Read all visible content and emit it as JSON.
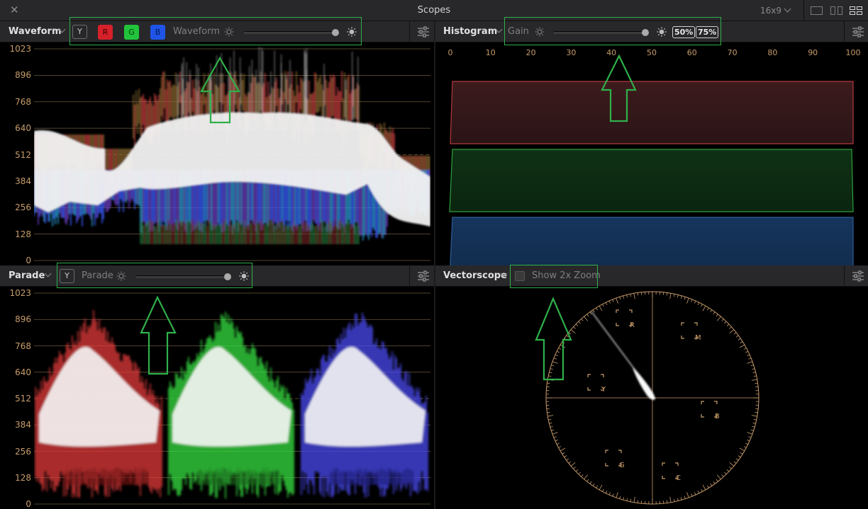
{
  "window": {
    "title": "Scopes",
    "aspect": "16x9"
  },
  "colors": {
    "accent_green": "#2fb04a",
    "tick_orange": "#c89c6a"
  },
  "waveform": {
    "title": "Waveform",
    "y_label": "Y",
    "r_label": "R",
    "g_label": "G",
    "b_label": "B",
    "mode_label": "Waveform",
    "brightness": 0.96,
    "y_ticks": [
      "1023",
      "896",
      "768",
      "640",
      "512",
      "384",
      "256",
      "128",
      "0"
    ]
  },
  "histogram": {
    "title": "Histogram",
    "gain_label": "Gain",
    "gain": 0.96,
    "btn_50": "50%",
    "btn_75": "75%",
    "x_ticks": [
      "0",
      "10",
      "20",
      "30",
      "40",
      "50",
      "60",
      "70",
      "80",
      "90",
      "100"
    ]
  },
  "parade": {
    "title": "Parade",
    "y_label": "Y",
    "mode_label": "Parade",
    "brightness": 0.96,
    "y_ticks": [
      "1023",
      "896",
      "768",
      "640",
      "512",
      "384",
      "256",
      "128",
      "0"
    ]
  },
  "vectorscope": {
    "title": "Vectorscope",
    "zoom_label": "Show 2x Zoom",
    "targets": [
      "R",
      "M",
      "B",
      "C",
      "G",
      "Y"
    ]
  },
  "icons": {
    "close": "close-icon",
    "settings": "settings-icon",
    "sun_dim": "sun-dim-icon",
    "sun_bright": "sun-bright-icon",
    "chevron": "chevron-down-icon"
  }
}
